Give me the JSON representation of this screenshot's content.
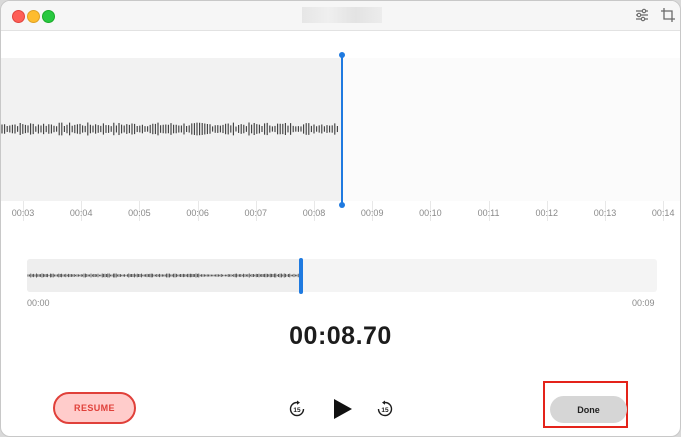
{
  "window": {
    "title": "",
    "toolbar_icons": [
      "sliders-icon",
      "crop-icon"
    ]
  },
  "timeline": {
    "labels": [
      "00:03",
      "00:04",
      "00:05",
      "00:06",
      "00:07",
      "00:08",
      "00:09",
      "00:10",
      "00:11",
      "00:12",
      "00:13",
      "00:14"
    ],
    "playhead_time": "00:08.70"
  },
  "overview": {
    "start_label": "00:00",
    "end_label": "00:09",
    "played_fraction": 0.435
  },
  "player": {
    "elapsed": "00:08.70",
    "skip_back_label": "15",
    "skip_forward_label": "15"
  },
  "actions": {
    "resume_label": "RESUME",
    "done_label": "Done"
  },
  "colors": {
    "accent": "#1f7ae0",
    "resume_text": "#e0403a",
    "resume_fill": "#ffcccb",
    "highlight": "#e4231a"
  }
}
